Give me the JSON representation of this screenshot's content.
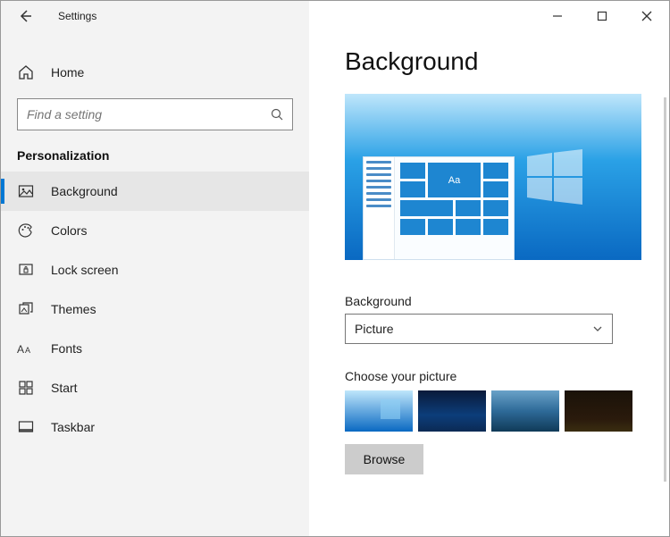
{
  "app_title": "Settings",
  "home_label": "Home",
  "search_placeholder": "Find a setting",
  "section_title": "Personalization",
  "nav": [
    {
      "id": "background",
      "label": "Background",
      "icon": "picture-icon",
      "active": true
    },
    {
      "id": "colors",
      "label": "Colors",
      "icon": "palette-icon",
      "active": false
    },
    {
      "id": "lock-screen",
      "label": "Lock screen",
      "icon": "lock-screen-icon",
      "active": false
    },
    {
      "id": "themes",
      "label": "Themes",
      "icon": "themes-icon",
      "active": false
    },
    {
      "id": "fonts",
      "label": "Fonts",
      "icon": "fonts-icon",
      "active": false
    },
    {
      "id": "start",
      "label": "Start",
      "icon": "start-icon",
      "active": false
    },
    {
      "id": "taskbar",
      "label": "Taskbar",
      "icon": "taskbar-icon",
      "active": false
    }
  ],
  "page_title": "Background",
  "background_label": "Background",
  "background_dropdown_value": "Picture",
  "choose_picture_label": "Choose your picture",
  "browse_label": "Browse",
  "preview_sample_text": "Aa"
}
